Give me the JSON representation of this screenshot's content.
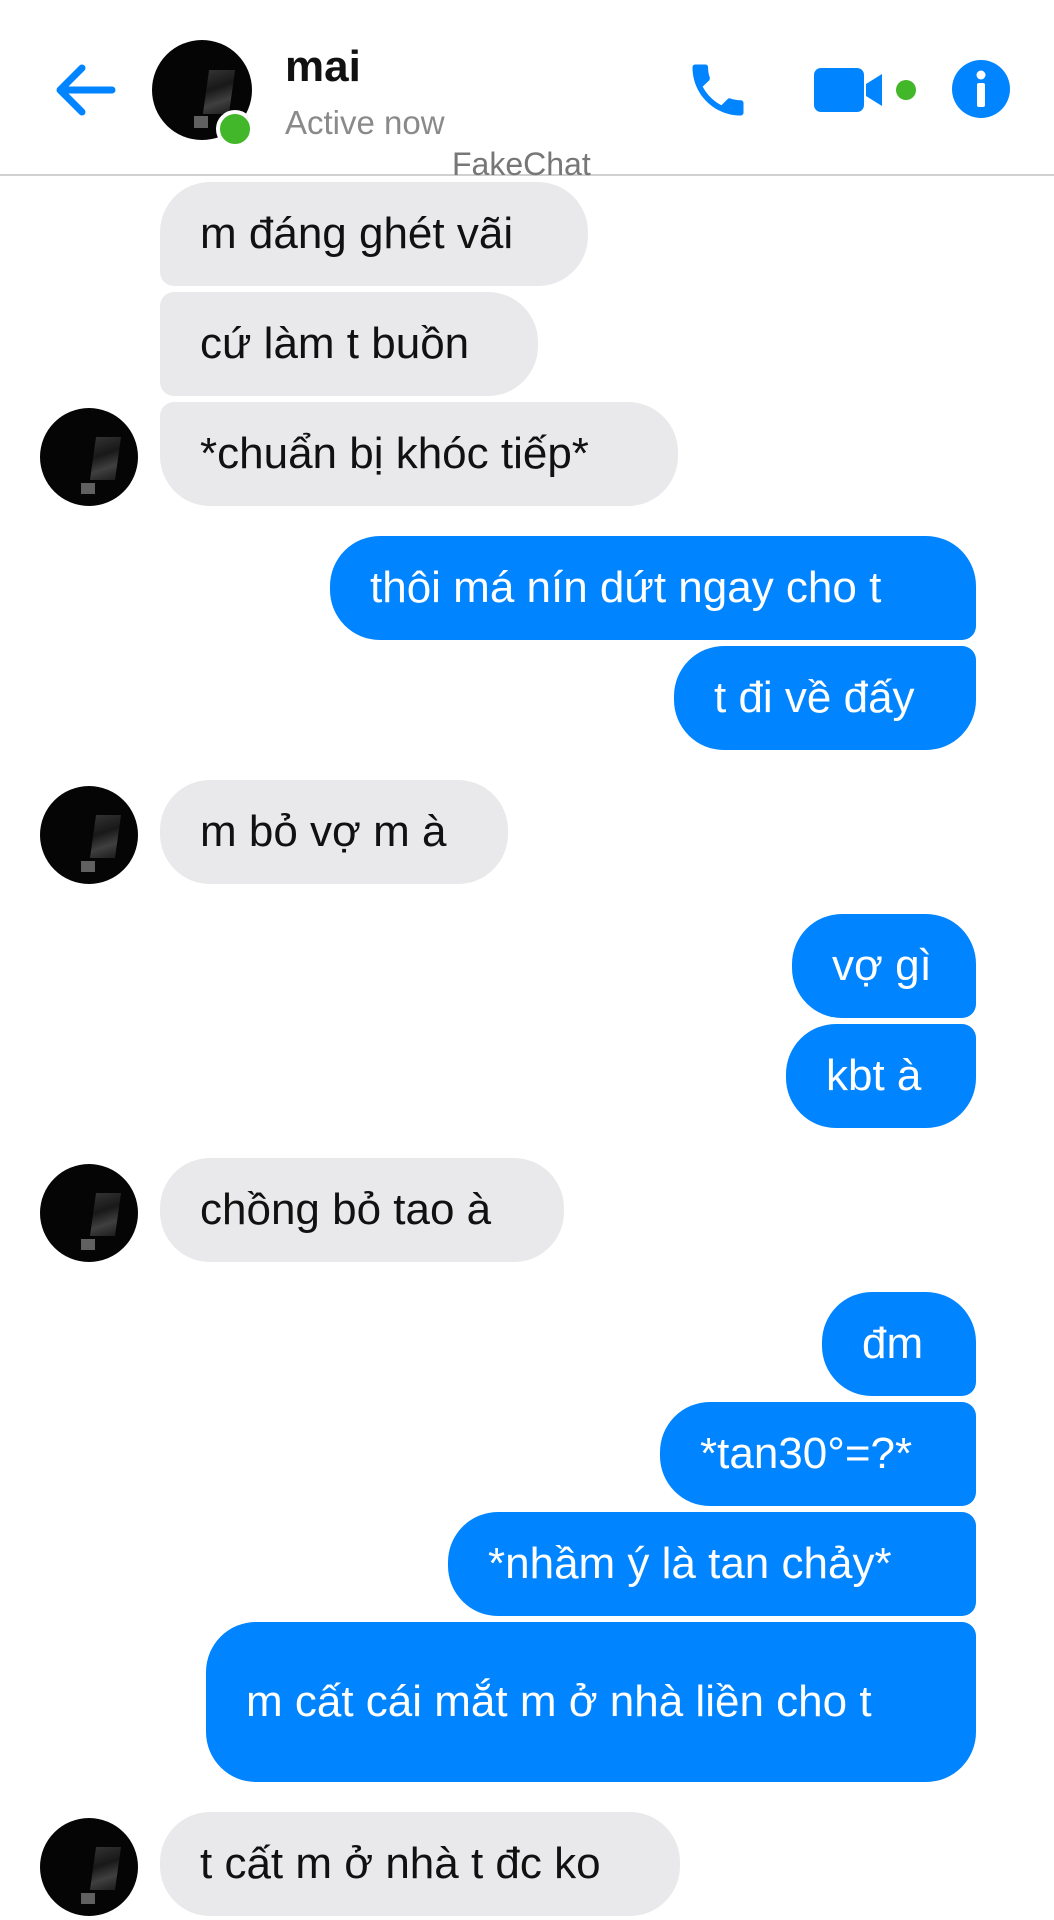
{
  "header": {
    "name": "mai",
    "status": "Active now",
    "watermark": "FakeChat"
  },
  "colors": {
    "accent": "#0084ff",
    "online": "#42b72a",
    "incoming_bubble": "#e9e9eb"
  },
  "icons": {
    "back": "arrow-left-icon",
    "call": "phone-icon",
    "video": "video-camera-icon",
    "info": "info-icon"
  },
  "messages": [
    {
      "from": "them",
      "text": "m đáng ghét vãi"
    },
    {
      "from": "them",
      "text": "cứ làm t buồn"
    },
    {
      "from": "them",
      "text": "*chuẩn bị khóc tiếp*"
    },
    {
      "from": "me",
      "text": "thôi má nín dứt ngay cho t"
    },
    {
      "from": "me",
      "text": "t đi về đấy"
    },
    {
      "from": "them",
      "text": "m bỏ vợ m à"
    },
    {
      "from": "me",
      "text": "vợ gì"
    },
    {
      "from": "me",
      "text": "kbt à"
    },
    {
      "from": "them",
      "text": "chồng bỏ tao à"
    },
    {
      "from": "me",
      "text": "đm"
    },
    {
      "from": "me",
      "text": "*tan30°=?*"
    },
    {
      "from": "me",
      "text": "*nhầm ý là tan chảy*"
    },
    {
      "from": "me",
      "text": "m cất cái mắt m ở nhà liền cho t"
    },
    {
      "from": "them",
      "text": "t cất m ở nhà t đc ko"
    }
  ]
}
